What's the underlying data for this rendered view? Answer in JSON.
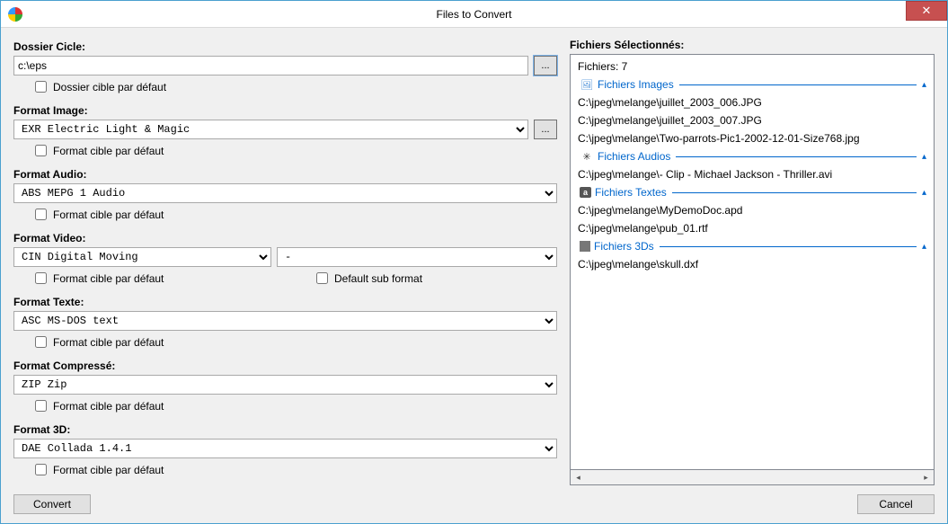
{
  "window": {
    "title": "Files to Convert"
  },
  "left": {
    "folder": {
      "label": "Dossier Cicle:",
      "value": "c:\\eps",
      "browse": "...",
      "chk": "Dossier cible par défaut"
    },
    "fmtImage": {
      "label": "Format Image:",
      "value": "EXR   Electric Light & Magic",
      "browse": "...",
      "chk": "Format cible par défaut"
    },
    "fmtAudio": {
      "label": "Format Audio:",
      "value": "ABS   MEPG 1 Audio",
      "chk": "Format cible par défaut"
    },
    "fmtVideo": {
      "label": "Format Video:",
      "value": "CIN   Digital Moving",
      "sub": "-",
      "chk": "Format cible par défaut",
      "chk2": "Default sub format"
    },
    "fmtText": {
      "label": "Format Texte:",
      "value": "ASC  MS-DOS text",
      "chk": "Format cible par défaut"
    },
    "fmtComp": {
      "label": "Format Compressé:",
      "value": "ZIP   Zip",
      "chk": "Format cible par défaut"
    },
    "fmt3d": {
      "label": "Format 3D:",
      "value": "DAE   Collada 1.4.1",
      "chk": "Format cible par défaut"
    }
  },
  "right": {
    "header": "Fichiers Sélectionnés:",
    "count": "Fichiers: 7",
    "groups": {
      "images": {
        "title": "Fichiers Images",
        "items": [
          "C:\\jpeg\\melange\\juillet_2003_006.JPG",
          "C:\\jpeg\\melange\\juillet_2003_007.JPG",
          "C:\\jpeg\\melange\\Two-parrots-Pic1-2002-12-01-Size768.jpg"
        ]
      },
      "audios": {
        "title": "Fichiers Audios",
        "items": [
          "C:\\jpeg\\melange\\- Clip - Michael Jackson - Thriller.avi"
        ]
      },
      "textes": {
        "title": "Fichiers Textes",
        "items": [
          "C:\\jpeg\\melange\\MyDemoDoc.apd",
          "C:\\jpeg\\melange\\pub_01.rtf"
        ]
      },
      "d3": {
        "title": "Fichiers 3Ds",
        "items": [
          "C:\\jpeg\\melange\\skull.dxf"
        ]
      }
    }
  },
  "footer": {
    "convert": "Convert",
    "cancel": "Cancel"
  }
}
